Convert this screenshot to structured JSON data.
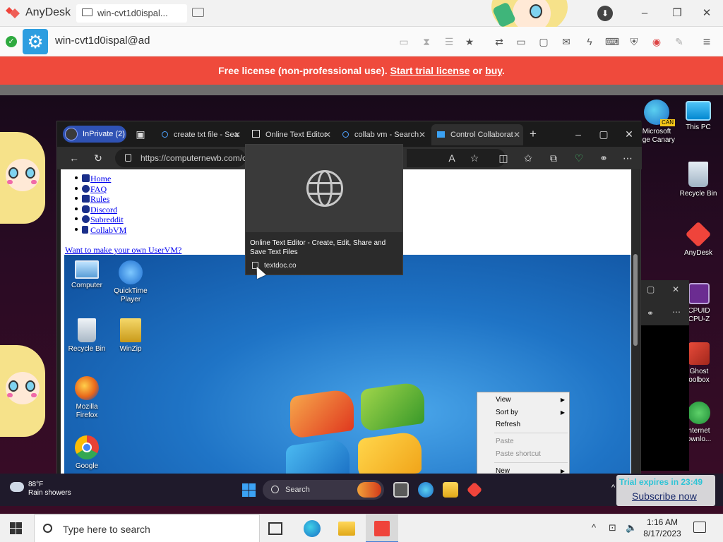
{
  "anydesk": {
    "app_name": "AnyDesk",
    "tab_label": "win-cvt1d0ispal...",
    "address": "win-cvt1d0ispal@ad",
    "window_controls": {
      "minimize": "–",
      "maximize": "❐",
      "close": "✕"
    },
    "icons": [
      "screen-mode-icon",
      "hourglass-icon",
      "database-icon",
      "favorite-icon",
      "file-transfer-icon",
      "monitor-icon",
      "chat-icon",
      "lightning-icon",
      "keyboard-icon",
      "privacy-icon",
      "record-icon",
      "whiteboard-icon",
      "menu-icon"
    ]
  },
  "license_bar": {
    "prefix": "Free license (non-professional use). ",
    "trial_link": "Start trial license",
    "middle": " or ",
    "buy_link": "buy",
    "suffix": "."
  },
  "host_desktop_icons": [
    {
      "label": "Microsoft Edge Canary",
      "line1": "Microsoft",
      "line2": "dge Canary",
      "badge": "CAN"
    },
    {
      "label": "This PC"
    },
    {
      "label": "Recycle Bin"
    },
    {
      "label": "AnyDesk"
    },
    {
      "label": "CPUID CPU-Z",
      "line1": "CPUID",
      "line2": "CPU-Z"
    },
    {
      "label": "Ghost Toolbox",
      "line1": "Ghost",
      "line2": "oolbox"
    },
    {
      "label": "Internet Download",
      "line1": "nternet",
      "line2": "ownlo..."
    }
  ],
  "edge": {
    "inprivate": "InPrivate (2)",
    "tabs": [
      {
        "title": "create txt file - Sea",
        "icon": "search-icon"
      },
      {
        "title": "Online Text Editor",
        "icon": "document-icon"
      },
      {
        "title": "collab vm - Search",
        "icon": "search-icon"
      },
      {
        "title": "Control Collaborat",
        "icon": "monitor-icon"
      }
    ],
    "new_tab": "+",
    "url": "https://computernewb.com/c",
    "window_controls": {
      "minimize": "–",
      "maximize": "▢",
      "close": "✕"
    }
  },
  "tab_tooltip": {
    "title": "Online Text Editor - Create, Edit, Share and Save Text Files",
    "domain": "textdoc.co"
  },
  "webpage": {
    "nav": [
      {
        "label": "Home",
        "icon": "home-icon"
      },
      {
        "label": "FAQ",
        "icon": "question-icon"
      },
      {
        "label": "Rules",
        "icon": "check-icon"
      },
      {
        "label": "Discord",
        "icon": "discord-icon"
      },
      {
        "label": "Subreddit",
        "icon": "reddit-icon"
      },
      {
        "label": "CollabVM",
        "icon": "user-icon"
      }
    ],
    "uservm_link": "Want to make your own UserVM?"
  },
  "vm_desktop": {
    "icons": [
      {
        "label": "Computer"
      },
      {
        "label": "QuickTime Player",
        "line1": "QuickTime",
        "line2": "Player"
      },
      {
        "label": "Recycle Bin"
      },
      {
        "label": "WinZip"
      },
      {
        "label": "Mozilla Firefox",
        "line1": "Mozilla",
        "line2": "Firefox"
      },
      {
        "label": "Google"
      }
    ],
    "context_menu": [
      {
        "label": "View",
        "submenu": true,
        "enabled": true
      },
      {
        "label": "Sort by",
        "submenu": true,
        "enabled": true
      },
      {
        "label": "Refresh",
        "submenu": false,
        "enabled": true
      },
      {
        "label": "Paste",
        "submenu": false,
        "enabled": false
      },
      {
        "label": "Paste shortcut",
        "submenu": false,
        "enabled": false
      },
      {
        "label": "New",
        "submenu": true,
        "enabled": true
      }
    ]
  },
  "remote_taskbar": {
    "weather_temp": "88°F",
    "weather_desc": "Rain showers",
    "search": "Search",
    "tray_chevron": "^"
  },
  "trial_overlay": {
    "expires": "Trial expires in 23:49",
    "subscribe": "Subscribe now"
  },
  "host_taskbar": {
    "search_placeholder": "Type here to search",
    "time": "1:16 AM",
    "date": "8/17/2023",
    "tray_chevron": "^"
  }
}
